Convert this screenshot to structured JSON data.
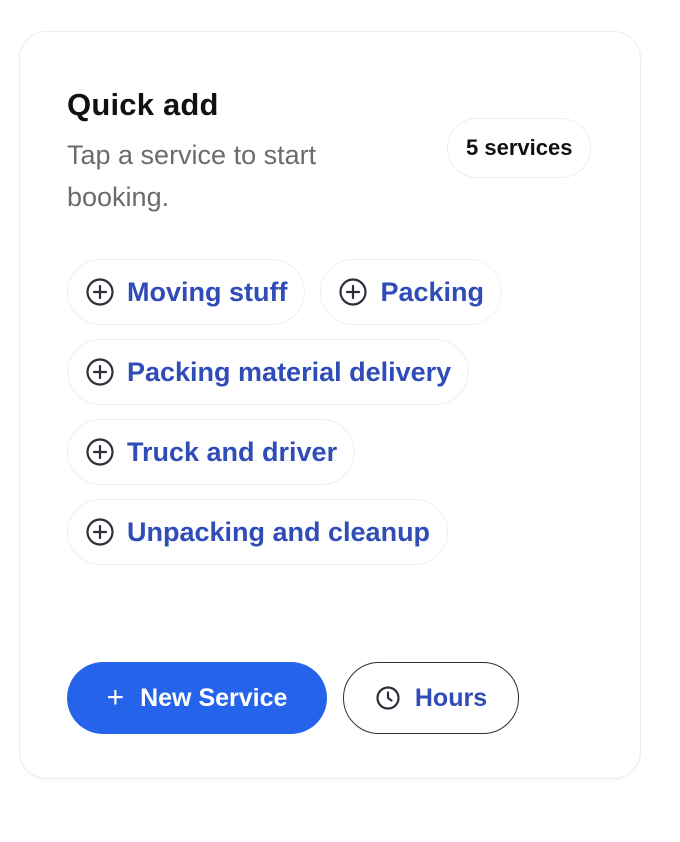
{
  "card": {
    "title": "Quick add",
    "subtitle": "Tap a service to start booking.",
    "count_badge": "5 services"
  },
  "services": [
    {
      "label": "Moving stuff",
      "icon": "plus-circle-icon"
    },
    {
      "label": "Packing",
      "icon": "plus-circle-icon"
    },
    {
      "label": "Packing material delivery",
      "icon": "plus-circle-icon"
    },
    {
      "label": "Truck and driver",
      "icon": "plus-circle-icon"
    },
    {
      "label": "Unpacking and cleanup",
      "icon": "plus-circle-icon"
    }
  ],
  "actions": {
    "new_service": {
      "icon": "plus-icon",
      "icon_glyph": "+",
      "label": "New Service"
    },
    "hours": {
      "icon": "clock-icon",
      "label": "Hours"
    }
  },
  "colors": {
    "accent": "#2563eb",
    "chip_text": "#2f4cb7",
    "title": "#111111",
    "subtitle": "#6b6b6b"
  }
}
